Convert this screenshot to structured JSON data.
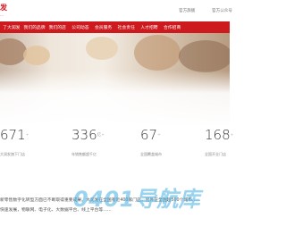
{
  "header": {
    "logo_text": "发",
    "logo_sub": "…",
    "links": [
      "官方旗舰",
      "官方公众号"
    ]
  },
  "nav": {
    "items": [
      "了大润发",
      "我们的品牌",
      "我们的店",
      "公司动态",
      "会员服务",
      "社会责任",
      "人才招聘",
      "合作招商"
    ]
  },
  "stats": [
    {
      "value": "671",
      "label": "大润发旗下门店"
    },
    {
      "value": "336",
      "label": "年销售额超千亿"
    },
    {
      "value": "67",
      "label": "全国覆盖城市"
    },
    {
      "value": "168",
      "label": "全国开业门店"
    }
  ],
  "about": {
    "line1": "新零售数字化转型方面已不断取得重要成果。大润发在全国有近400家门店，另外在全国超500个城市……",
    "line2": "快速发展，物联网、电子化、大数据平台、线上平台等……"
  },
  "watermark": "0401导航库",
  "colors": {
    "brand_red": "#cc1a1f",
    "watermark_blue": "#46afe1"
  }
}
